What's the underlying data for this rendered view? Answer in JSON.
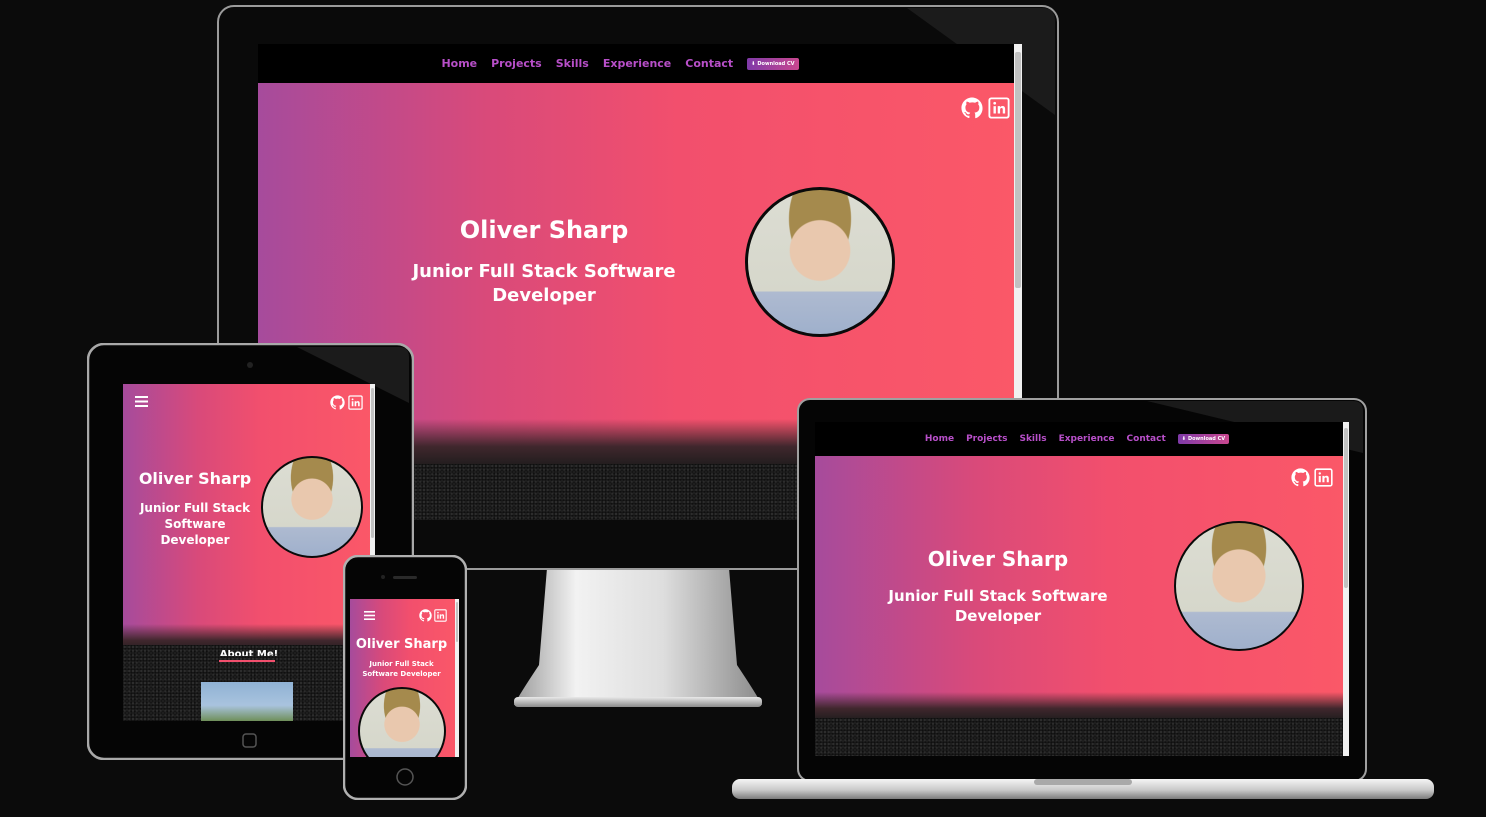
{
  "site": {
    "nav": [
      "Home",
      "Projects",
      "Skills",
      "Experience",
      "Contact"
    ],
    "cv_button": "Download CV",
    "name": "Oliver Sharp",
    "role": "Junior Full Stack Software Developer",
    "about_heading": "About Me!",
    "icons": [
      "github-icon",
      "linkedin-icon",
      "download-icon",
      "hamburger-icon"
    ]
  },
  "colors": {
    "gradient_start": "#a64b9c",
    "gradient_end": "#fb5868",
    "nav_link": "#b84fc9",
    "nav_bg": "#000000",
    "page_bg": "#0b0b0b"
  }
}
